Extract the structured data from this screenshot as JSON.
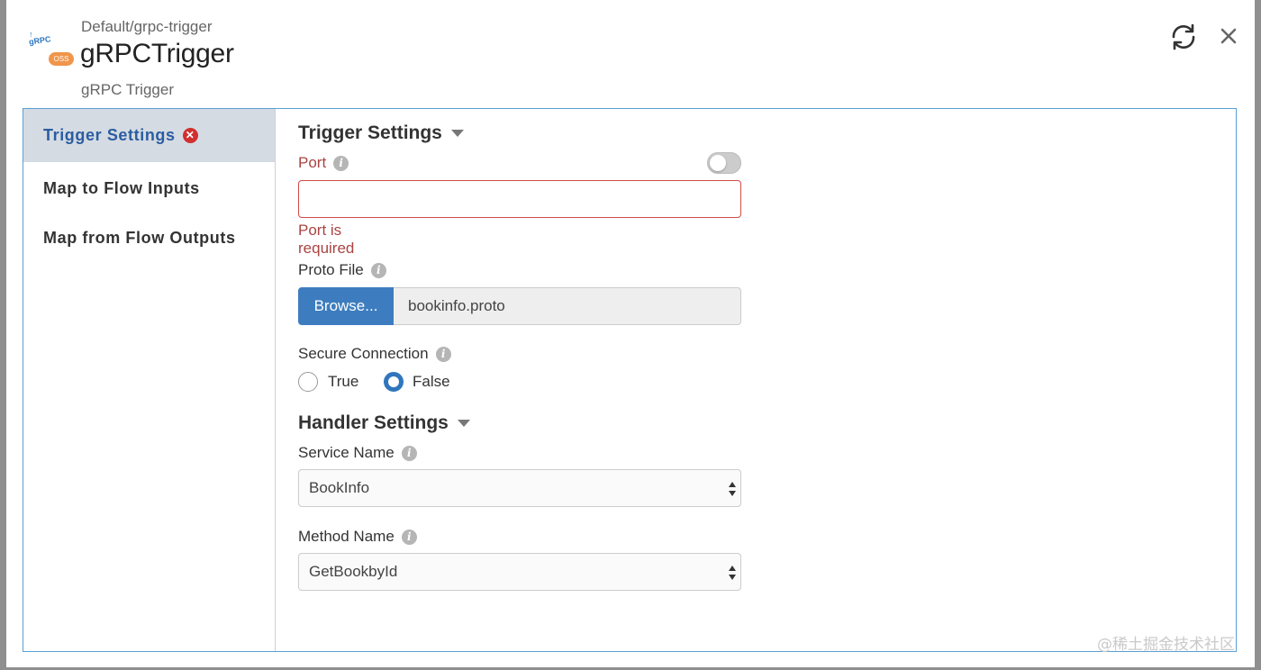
{
  "header": {
    "breadcrumb": "Default/grpc-trigger",
    "title": "gRPCTrigger",
    "subtitle": "gRPC Trigger",
    "logo_text": "gRPC",
    "logo_badge": "OSS"
  },
  "sidebar": {
    "items": [
      {
        "label": "Trigger Settings",
        "active": true,
        "error_icon": "x-circle-icon"
      },
      {
        "label": "Map to Flow Inputs",
        "active": false
      },
      {
        "label": "Map from Flow Outputs",
        "active": false
      }
    ]
  },
  "trigger_settings": {
    "heading": "Trigger Settings",
    "port": {
      "label": "Port",
      "value": "",
      "error": "Port is required",
      "toggle_on": false
    },
    "proto_file": {
      "label": "Proto File",
      "browse_label": "Browse...",
      "file_name": "bookinfo.proto"
    },
    "secure_connection": {
      "label": "Secure Connection",
      "options": [
        {
          "label": "True",
          "checked": false
        },
        {
          "label": "False",
          "checked": true
        }
      ]
    }
  },
  "handler_settings": {
    "heading": "Handler Settings",
    "service_name": {
      "label": "Service Name",
      "value": "BookInfo"
    },
    "method_name": {
      "label": "Method Name",
      "value": "GetBookbyId"
    }
  },
  "icons": {
    "info": "info-icon",
    "refresh": "refresh-icon",
    "close": "close-icon"
  },
  "colors": {
    "accent": "#3d7dbf",
    "error": "#a94442",
    "active_nav_bg": "#d5dbe3"
  },
  "watermark": "@稀土掘金技术社区"
}
